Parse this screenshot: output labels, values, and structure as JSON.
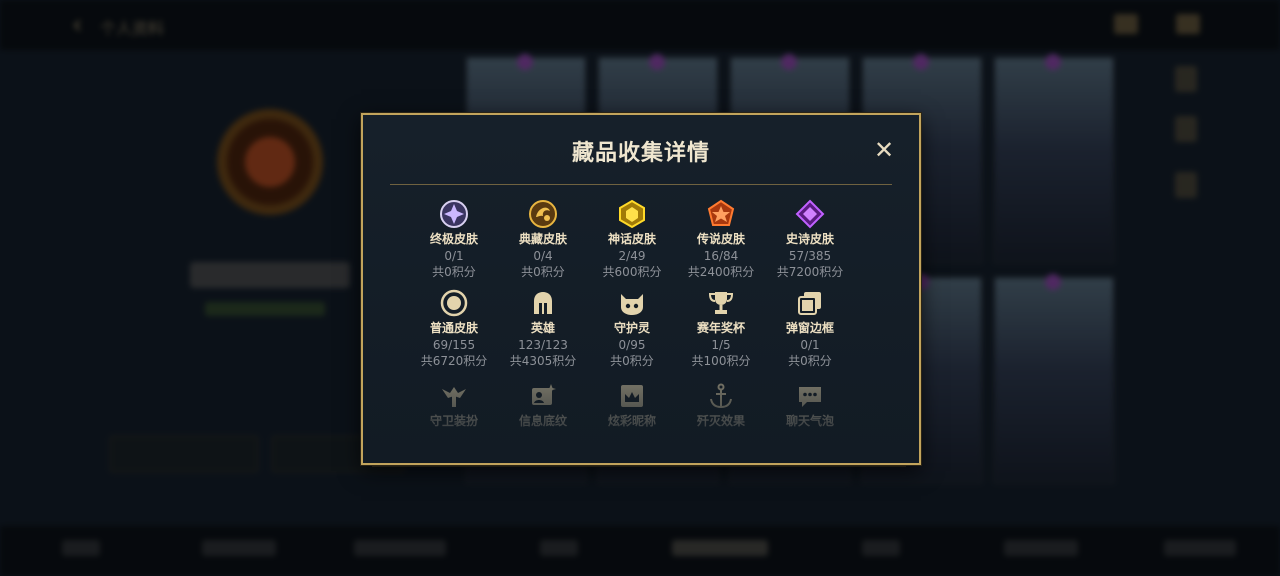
{
  "background": {
    "title": "个人资料"
  },
  "modal": {
    "title": "藏品收集详情",
    "close_label": "✕",
    "items": [
      {
        "label": "终极皮肤",
        "count": "0/1",
        "points": "共0积分",
        "icon": "ultimate-skin-icon",
        "color": "#b9a2e8"
      },
      {
        "label": "典藏皮肤",
        "count": "0/4",
        "points": "共0积分",
        "icon": "collector-skin-icon",
        "color": "#d8a73a"
      },
      {
        "label": "神话皮肤",
        "count": "2/49",
        "points": "共600积分",
        "icon": "mythic-skin-icon",
        "color": "#e8c320"
      },
      {
        "label": "传说皮肤",
        "count": "16/84",
        "points": "共2400积分",
        "icon": "legendary-skin-icon",
        "color": "#e8642a"
      },
      {
        "label": "史诗皮肤",
        "count": "57/385",
        "points": "共7200积分",
        "icon": "epic-skin-icon",
        "color": "#a63ad8"
      },
      {
        "label": "普通皮肤",
        "count": "69/155",
        "points": "共6720积分",
        "icon": "normal-skin-icon",
        "color": "#d9caa2"
      },
      {
        "label": "英雄",
        "count": "123/123",
        "points": "共4305积分",
        "icon": "helmet-icon",
        "color": "#d9caa2"
      },
      {
        "label": "守护灵",
        "count": "0/95",
        "points": "共0积分",
        "icon": "guardian-spirit-icon",
        "color": "#d9caa2"
      },
      {
        "label": "赛年奖杯",
        "count": "1/5",
        "points": "共100积分",
        "icon": "trophy-icon",
        "color": "#d9caa2"
      },
      {
        "label": "弹窗边框",
        "count": "0/1",
        "points": "共0积分",
        "icon": "popup-frame-icon",
        "color": "#d9caa2"
      },
      {
        "label": "守卫装扮",
        "icon": "ward-skin-icon",
        "color": "#d9caa2"
      },
      {
        "label": "信息底纹",
        "icon": "info-card-icon",
        "color": "#d9caa2"
      },
      {
        "label": "炫彩昵称",
        "icon": "colorful-name-icon",
        "color": "#d9caa2"
      },
      {
        "label": "歼灭效果",
        "icon": "anchor-icon",
        "color": "#d9caa2"
      },
      {
        "label": "聊天气泡",
        "icon": "chat-bubble-icon",
        "color": "#d9caa2"
      }
    ]
  }
}
